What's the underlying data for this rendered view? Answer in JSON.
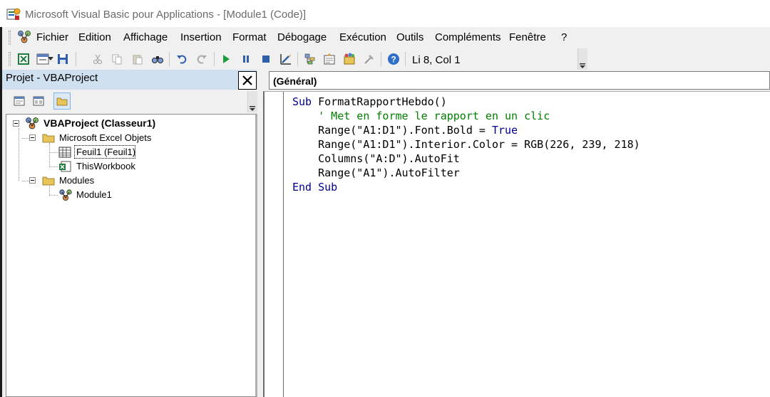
{
  "window": {
    "title": "Microsoft Visual Basic pour Applications - [Module1 (Code)]"
  },
  "menu": {
    "items": [
      {
        "label": "Fichier"
      },
      {
        "label": "Edition"
      },
      {
        "label": "Affichage"
      },
      {
        "label": "Insertion"
      },
      {
        "label": "Format"
      },
      {
        "label": "Débogage"
      },
      {
        "label": "Exécution"
      },
      {
        "label": "Outils"
      },
      {
        "label": "Compléments"
      },
      {
        "label": "Fenêtre"
      },
      {
        "label": "?"
      }
    ]
  },
  "toolbar": {
    "buttons": [
      {
        "icon": "excel-view-icon"
      },
      {
        "icon": "insert-userform-icon"
      },
      {
        "icon": "dropdown-icon"
      },
      {
        "icon": "save-icon"
      },
      {
        "icon": "cut-icon"
      },
      {
        "icon": "copy-icon"
      },
      {
        "icon": "paste-icon"
      },
      {
        "icon": "find-icon"
      },
      {
        "icon": "undo-icon"
      },
      {
        "icon": "redo-icon"
      },
      {
        "icon": "run-icon"
      },
      {
        "icon": "break-icon"
      },
      {
        "icon": "reset-icon"
      },
      {
        "icon": "design-mode-icon"
      },
      {
        "icon": "project-explorer-icon"
      },
      {
        "icon": "properties-icon"
      },
      {
        "icon": "object-browser-icon"
      },
      {
        "icon": "toolbox-icon"
      },
      {
        "icon": "help-icon"
      }
    ],
    "cursor_position": "Li 8, Col 1"
  },
  "project_pane": {
    "title": "Projet - VBAProject",
    "tree": {
      "root": "VBAProject (Classeur1)",
      "excel_objects_folder": "Microsoft Excel Objets",
      "sheet1": "Feuil1 (Feuil1)",
      "workbook": "ThisWorkbook",
      "modules_folder": "Modules",
      "module1": "Module1"
    }
  },
  "code_window": {
    "object_combo": "(Général)",
    "lines": [
      {
        "kw": "Sub",
        "rest": " FormatRapportHebdo()"
      },
      {
        "comment": "    ' Met en forme le rapport en un clic"
      },
      {
        "pre": "    Range(\"A1:D1\").Font.Bold = ",
        "kw": "True"
      },
      {
        "text": "    Range(\"A1:D1\").Interior.Color = RGB(226, 239, 218)"
      },
      {
        "text": "    Columns(\"A:D\").AutoFit"
      },
      {
        "text": "    Range(\"A1\").AutoFilter"
      },
      {
        "kw": "End Sub"
      }
    ]
  },
  "colors": {
    "keyword": "#00008b",
    "comment": "#008000",
    "pane_header": "#cfe0f0"
  }
}
